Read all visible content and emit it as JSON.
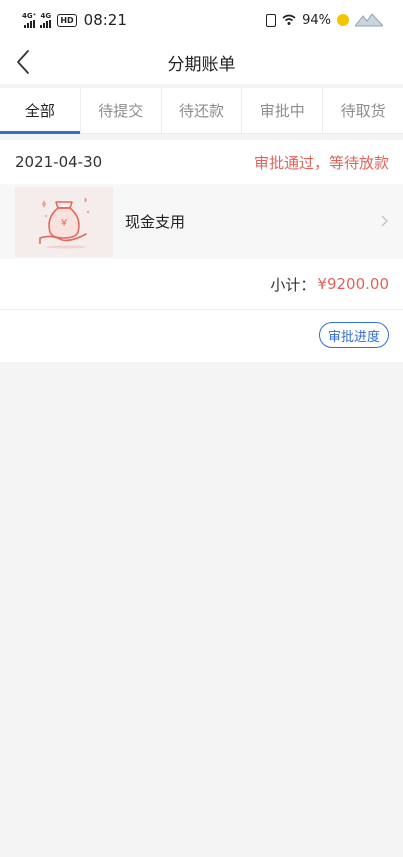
{
  "status_bar": {
    "network_1": "4G⁺",
    "network_2": "4G",
    "hd_badge": "HD",
    "time": "08:21",
    "battery": "94%"
  },
  "nav": {
    "title": "分期账单"
  },
  "tabs": [
    {
      "label": "全部",
      "active": true
    },
    {
      "label": "待提交",
      "active": false
    },
    {
      "label": "待还款",
      "active": false
    },
    {
      "label": "审批中",
      "active": false
    },
    {
      "label": "待取货",
      "active": false
    }
  ],
  "order": {
    "date": "2021-04-30",
    "status": "审批通过，等待放款",
    "product_name": "现金支用",
    "subtotal_label": "小计：",
    "subtotal_amount": "¥9200.00",
    "action_label": "审批进度"
  },
  "colors": {
    "accent": "#2f6fcf",
    "status_red": "#e0645c",
    "background": "#f4f4f5"
  }
}
